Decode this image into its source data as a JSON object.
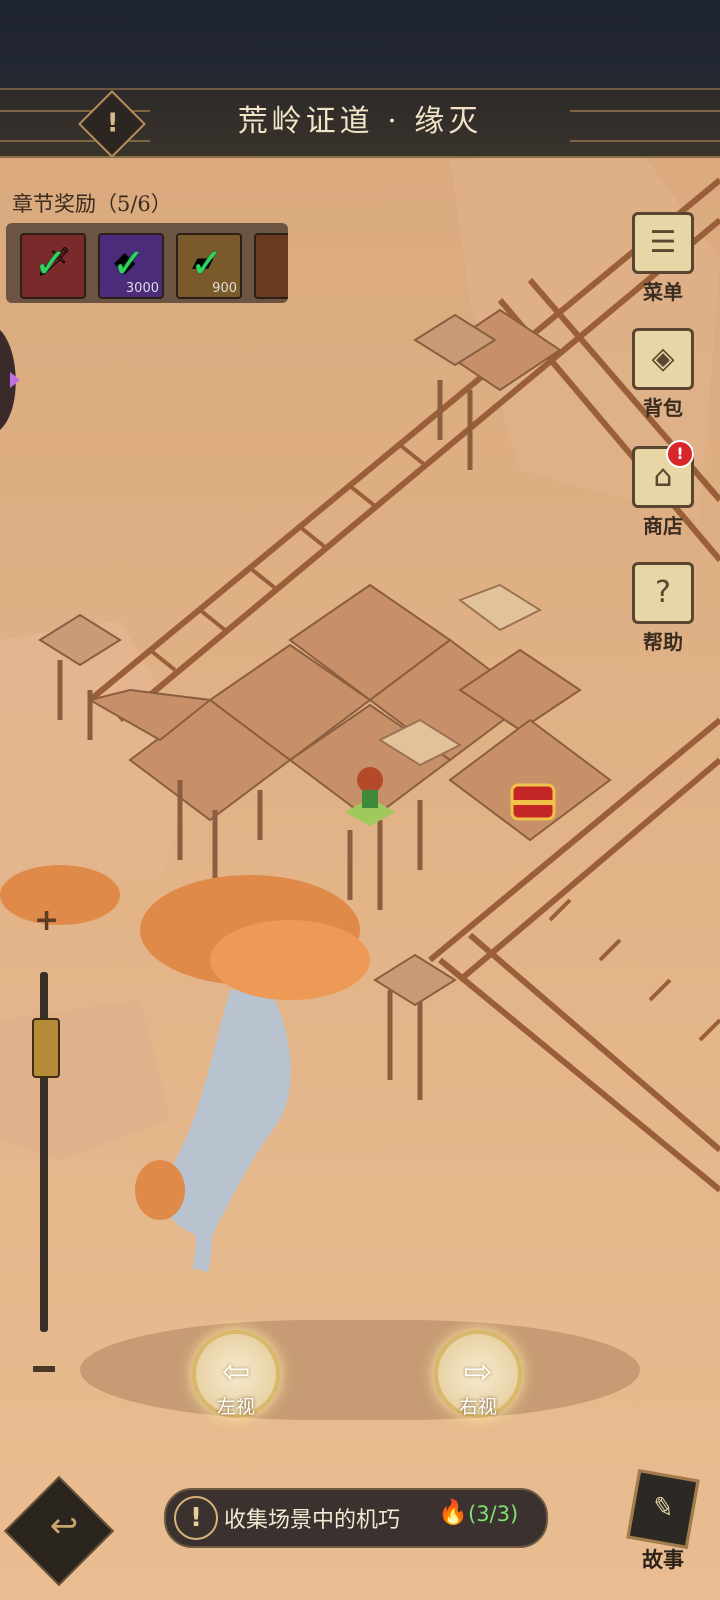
{
  "header": {
    "title": "荒岭证道 · 缘灭",
    "warn_icon_glyph": "!"
  },
  "rewards": {
    "label": "章节奖励（5/6）",
    "items": [
      {
        "icon": "sword-icon",
        "glyph": "🗡",
        "bg": "#7a2a2a",
        "qty": "",
        "claimed": true
      },
      {
        "icon": "gem-icon",
        "glyph": "◆",
        "bg": "#4b2b7a",
        "qty": "3000",
        "claimed": true
      },
      {
        "icon": "ingot-icon",
        "glyph": "▰",
        "bg": "#7a5a2a",
        "qty": "900",
        "claimed": true
      }
    ]
  },
  "side_menu": {
    "menu": {
      "label": "菜单",
      "icon": "scroll-icon",
      "glyph": "☰"
    },
    "bag": {
      "label": "背包",
      "icon": "bag-icon",
      "glyph": "◈"
    },
    "shop": {
      "label": "商店",
      "icon": "shop-icon",
      "glyph": "⌂",
      "badge": "!"
    },
    "help": {
      "label": "帮助",
      "icon": "help-scroll-icon",
      "glyph": "?"
    }
  },
  "zoom": {
    "plus": "+",
    "level_fraction": 0.2
  },
  "view": {
    "left_label": "左视",
    "right_label": "右视",
    "left_arrow": "⇦",
    "right_arrow": "⇨"
  },
  "quest": {
    "icon_glyph": "!",
    "text": "收集场景中的机巧",
    "flame": "🔥",
    "count": "(3/3)"
  },
  "story": {
    "label": "故事",
    "glyph": "✎"
  },
  "back": {
    "glyph": "↩"
  },
  "colors": {
    "ground": "#e6b98c",
    "platform": "#c79068",
    "rail": "#9a5f38",
    "tree_leaves": "#e08a4a",
    "tree_trunk": "#b9c3cf"
  }
}
